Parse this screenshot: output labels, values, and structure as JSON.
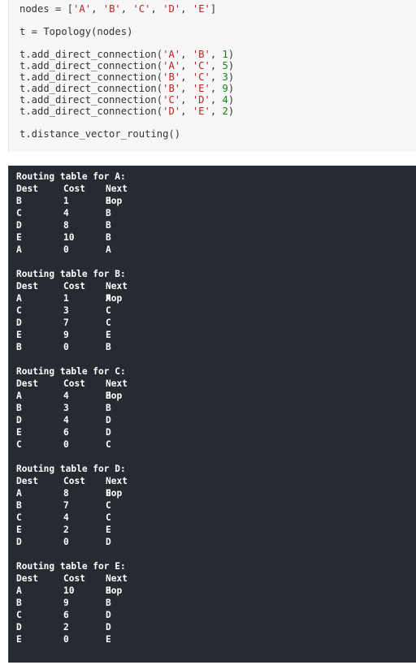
{
  "code": {
    "lines": [
      [
        {
          "t": "nodes = [",
          "c": ""
        },
        {
          "t": "'A'",
          "c": "str"
        },
        {
          "t": ", ",
          "c": ""
        },
        {
          "t": "'B'",
          "c": "str"
        },
        {
          "t": ", ",
          "c": ""
        },
        {
          "t": "'C'",
          "c": "str"
        },
        {
          "t": ", ",
          "c": ""
        },
        {
          "t": "'D'",
          "c": "str"
        },
        {
          "t": ", ",
          "c": ""
        },
        {
          "t": "'E'",
          "c": "str"
        },
        {
          "t": "]",
          "c": ""
        }
      ],
      [],
      [
        {
          "t": "t = Topology(nodes)",
          "c": ""
        }
      ],
      [],
      [
        {
          "t": "t.add_direct_connection(",
          "c": ""
        },
        {
          "t": "'A'",
          "c": "str"
        },
        {
          "t": ", ",
          "c": ""
        },
        {
          "t": "'B'",
          "c": "str"
        },
        {
          "t": ", ",
          "c": ""
        },
        {
          "t": "1",
          "c": "num"
        },
        {
          "t": ")",
          "c": ""
        }
      ],
      [
        {
          "t": "t.add_direct_connection(",
          "c": ""
        },
        {
          "t": "'A'",
          "c": "str"
        },
        {
          "t": ", ",
          "c": ""
        },
        {
          "t": "'C'",
          "c": "str"
        },
        {
          "t": ", ",
          "c": ""
        },
        {
          "t": "5",
          "c": "num"
        },
        {
          "t": ")",
          "c": ""
        }
      ],
      [
        {
          "t": "t.add_direct_connection(",
          "c": ""
        },
        {
          "t": "'B'",
          "c": "str"
        },
        {
          "t": ", ",
          "c": ""
        },
        {
          "t": "'C'",
          "c": "str"
        },
        {
          "t": ", ",
          "c": ""
        },
        {
          "t": "3",
          "c": "num"
        },
        {
          "t": ")",
          "c": ""
        }
      ],
      [
        {
          "t": "t.add_direct_connection(",
          "c": ""
        },
        {
          "t": "'B'",
          "c": "str"
        },
        {
          "t": ", ",
          "c": ""
        },
        {
          "t": "'E'",
          "c": "str"
        },
        {
          "t": ", ",
          "c": ""
        },
        {
          "t": "9",
          "c": "num"
        },
        {
          "t": ")",
          "c": ""
        }
      ],
      [
        {
          "t": "t.add_direct_connection(",
          "c": ""
        },
        {
          "t": "'C'",
          "c": "str"
        },
        {
          "t": ", ",
          "c": ""
        },
        {
          "t": "'D'",
          "c": "str"
        },
        {
          "t": ", ",
          "c": ""
        },
        {
          "t": "4",
          "c": "num"
        },
        {
          "t": ")",
          "c": ""
        }
      ],
      [
        {
          "t": "t.add_direct_connection(",
          "c": ""
        },
        {
          "t": "'D'",
          "c": "str"
        },
        {
          "t": ", ",
          "c": ""
        },
        {
          "t": "'E'",
          "c": "str"
        },
        {
          "t": ", ",
          "c": ""
        },
        {
          "t": "2",
          "c": "num"
        },
        {
          "t": ")",
          "c": ""
        }
      ],
      [],
      [
        {
          "t": "t.distance_vector_routing()",
          "c": ""
        }
      ]
    ]
  },
  "output": {
    "header": [
      "Dest",
      "Cost",
      "Next Hop"
    ],
    "tables": [
      {
        "title": "Routing table for A:",
        "rows": [
          [
            "B",
            "1",
            "B"
          ],
          [
            "C",
            "4",
            "B"
          ],
          [
            "D",
            "8",
            "B"
          ],
          [
            "E",
            "10",
            "B"
          ],
          [
            "A",
            "0",
            "A"
          ]
        ]
      },
      {
        "title": "Routing table for B:",
        "rows": [
          [
            "A",
            "1",
            "A"
          ],
          [
            "C",
            "3",
            "C"
          ],
          [
            "D",
            "7",
            "C"
          ],
          [
            "E",
            "9",
            "E"
          ],
          [
            "B",
            "0",
            "B"
          ]
        ]
      },
      {
        "title": "Routing table for C:",
        "rows": [
          [
            "A",
            "4",
            "B"
          ],
          [
            "B",
            "3",
            "B"
          ],
          [
            "D",
            "4",
            "D"
          ],
          [
            "E",
            "6",
            "D"
          ],
          [
            "C",
            "0",
            "C"
          ]
        ]
      },
      {
        "title": "Routing table for D:",
        "rows": [
          [
            "A",
            "8",
            "C"
          ],
          [
            "B",
            "7",
            "C"
          ],
          [
            "C",
            "4",
            "C"
          ],
          [
            "E",
            "2",
            "E"
          ],
          [
            "D",
            "0",
            "D"
          ]
        ]
      },
      {
        "title": "Routing table for E:",
        "rows": [
          [
            "A",
            "10",
            "B"
          ],
          [
            "B",
            "9",
            "B"
          ],
          [
            "C",
            "6",
            "D"
          ],
          [
            "D",
            "2",
            "D"
          ],
          [
            "E",
            "0",
            "E"
          ]
        ]
      }
    ]
  },
  "colors": {
    "string": "#ba2121",
    "number": "#0a8a0a",
    "output_bg": "#262a31",
    "code_bg": "#f7f7f7"
  }
}
